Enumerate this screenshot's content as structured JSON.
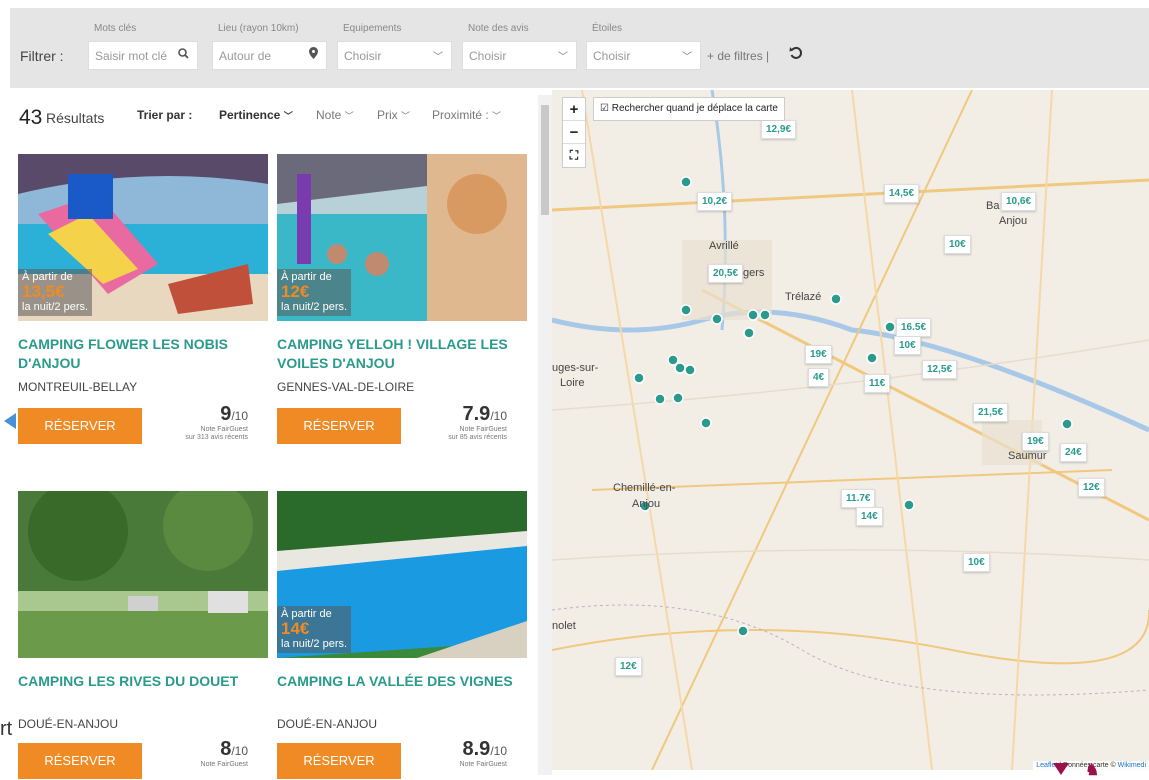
{
  "filters": {
    "label": "Filtrer :",
    "keywords": {
      "label": "Mots clés",
      "placeholder": "Saisir mot clé"
    },
    "place": {
      "label": "Lieu (rayon 10km)",
      "placeholder": "Autour de"
    },
    "equipment": {
      "label": "Equipements",
      "value": "Choisir"
    },
    "reviews": {
      "label": "Note des avis",
      "value": "Choisir"
    },
    "stars": {
      "label": "Étoiles",
      "value": "Choisir"
    },
    "more": "+ de filtres",
    "separator": "|"
  },
  "results": {
    "count": "43",
    "count_label": "Résultats",
    "sort_label": "Trier par :",
    "sort_options": [
      "Pertinence",
      "Note",
      "Prix",
      "Proximité :"
    ]
  },
  "icons": {
    "chevron": "⌄",
    "search": "🔍",
    "pin": "📍",
    "reset": "↺"
  },
  "cards": [
    {
      "title": "Camping Flower Les Nobis d'Anjou",
      "city": "Montreuil-Bellay",
      "price_from": "À partir de",
      "price": "13,5€",
      "price_unit": "la nuit/2 pers.",
      "reserve": "Réserver",
      "rating": "9",
      "rating_den": "/10",
      "rating_source": "Note FairGuest",
      "rating_reviews": "sur 313 avis récents"
    },
    {
      "title": "Camping Yelloh ! Village Les Voiles d'Anjou",
      "city": "Gennes-Val-de-Loire",
      "price_from": "À partir de",
      "price": "12€",
      "price_unit": "la nuit/2 pers.",
      "reserve": "Réserver",
      "rating": "7.9",
      "rating_den": "/10",
      "rating_source": "Note FairGuest",
      "rating_reviews": "sur 85 avis récents"
    },
    {
      "title": "Camping Les Rives du Douet",
      "city": "Doué-en-Anjou",
      "price_from": "",
      "price": "",
      "price_unit": "",
      "reserve": "Réserver",
      "rating": "8",
      "rating_den": "/10",
      "rating_source": "Note FairGuest",
      "rating_reviews": ""
    },
    {
      "title": "Camping La Vallée des Vignes",
      "city": "Doué-en-Anjou",
      "price_from": "À partir de",
      "price": "14€",
      "price_unit": "la nuit/2 pers.",
      "reserve": "Réserver",
      "rating": "8.9",
      "rating_den": "/10",
      "rating_source": "Note FairGuest",
      "rating_reviews": ""
    }
  ],
  "map": {
    "zoom_in": "+",
    "zoom_out": "−",
    "fullscreen": "⛶",
    "search_on_move": "☑ Rechercher quand je déplace la carte",
    "prices": [
      "12,9€",
      "10,2€",
      "14,5€",
      "10,6€",
      "10€",
      "20,5€",
      "16.5€",
      "10€",
      "19€",
      "4€",
      "12,5€",
      "11€",
      "21,5€",
      "19€",
      "24€",
      "12€",
      "11.7€",
      "14€",
      "10€",
      "12€"
    ],
    "places": [
      "Avrillé",
      "gers",
      "Trélazé",
      "Ba",
      "Anjou",
      "uges-sur-",
      "Loire",
      "Saumur",
      "Chemillé-en-",
      "Anjou",
      "nolet"
    ],
    "attribution_link": "Leaflet",
    "attribution_text": "| Données carte ©",
    "attribution_link2": "Wikimedi"
  },
  "stray_text": "rt"
}
